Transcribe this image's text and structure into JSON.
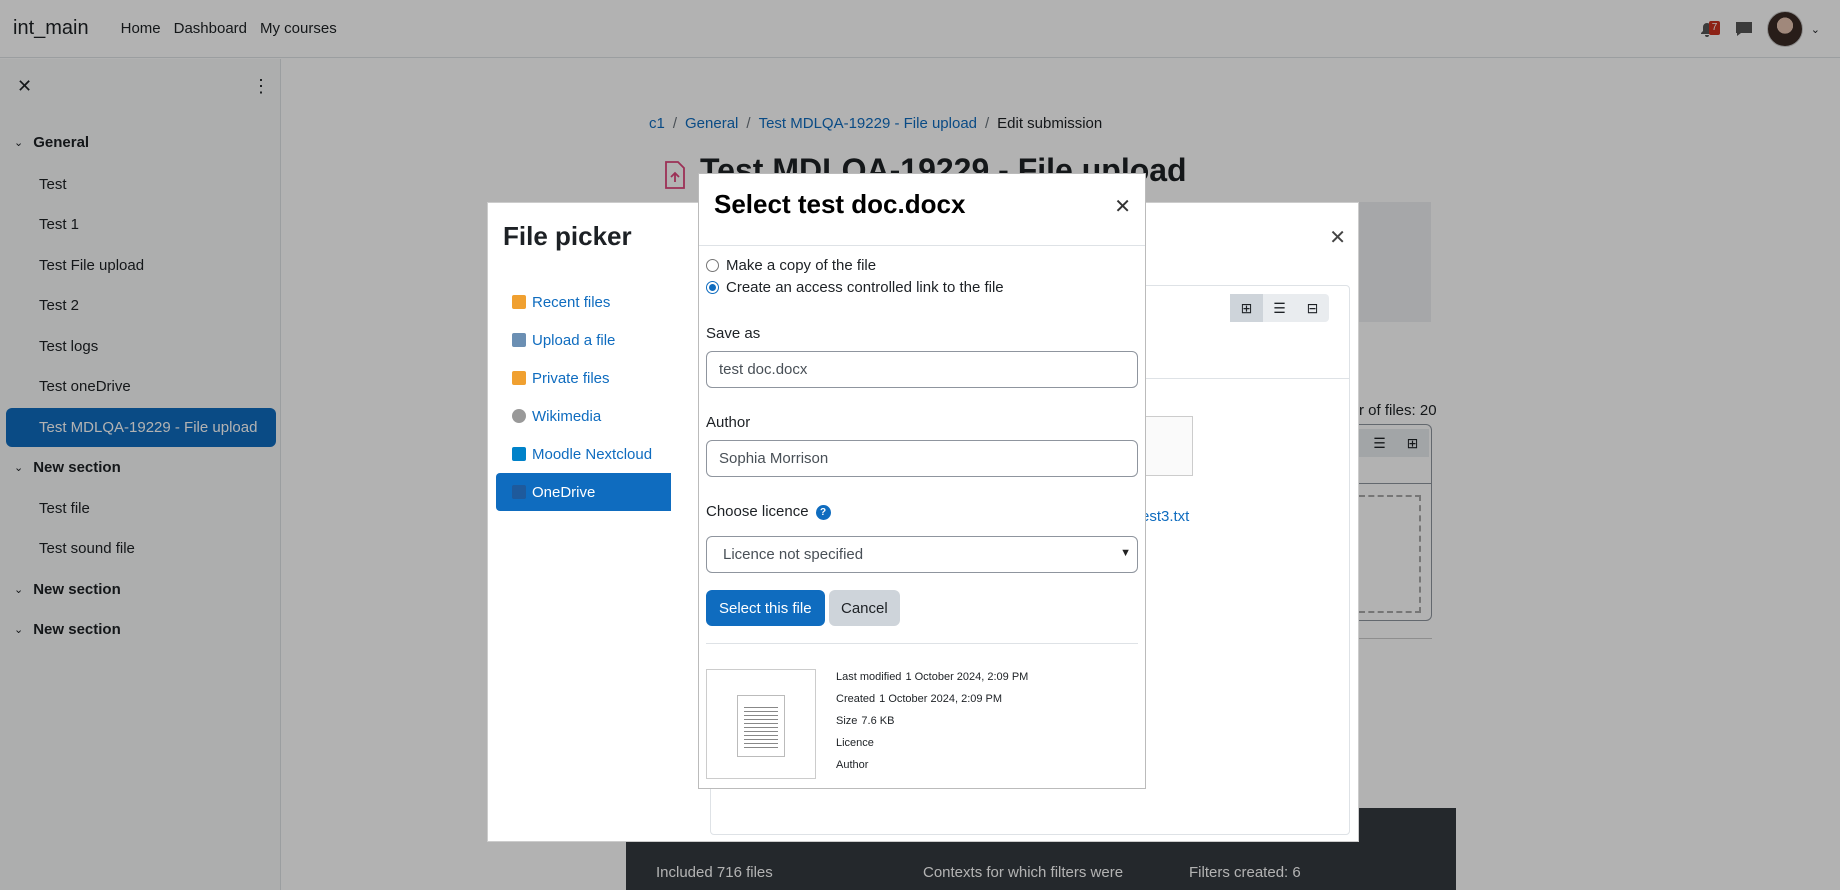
{
  "navbar": {
    "brand": "int_main",
    "links": [
      "Home",
      "Dashboard",
      "My courses"
    ],
    "notification_count": "7"
  },
  "drawer": {
    "sections": [
      {
        "title": "General",
        "items": [
          "Test",
          "Test 1",
          "Test File upload",
          "Test 2",
          "Test logs",
          "Test oneDrive",
          "Test MDLQA-19229 - File upload"
        ]
      },
      {
        "title": "New section",
        "items": [
          "Test file",
          "Test sound file"
        ]
      },
      {
        "title": "New section",
        "items": []
      },
      {
        "title": "New section",
        "items": []
      }
    ],
    "active_item": "Test MDLQA-19229 - File upload"
  },
  "breadcrumb": [
    "c1",
    "General",
    "Test MDLQA-19229 - File upload",
    "Edit submission"
  ],
  "page_heading": "Test MDLQA-19229 - File upload",
  "footer": {
    "included": "Included 716 files",
    "contexts": "Contexts for which filters were",
    "filters": "Filters created: 6"
  },
  "behind": {
    "files_count": "r of files: 20",
    "filename": "est3.txt"
  },
  "file_picker": {
    "title": "File picker",
    "repos": [
      "Recent files",
      "Upload a file",
      "Private files",
      "Wikimedia",
      "Moodle Nextcloud",
      "OneDrive"
    ],
    "active_repo": "OneDrive"
  },
  "dialog": {
    "title": "Select test doc.docx",
    "radio_copy": "Make a copy of the file",
    "radio_link": "Create an access controlled link to the file",
    "save_as_label": "Save as",
    "save_as_value": "test doc.docx",
    "author_label": "Author",
    "author_value": "Sophia Morrison",
    "licence_label": "Choose licence",
    "licence_value": "Licence not specified",
    "select_button": "Select this file",
    "cancel_button": "Cancel",
    "meta": {
      "last_modified_label": "Last modified",
      "last_modified": "1 October 2024, 2:09 PM",
      "created_label": "Created",
      "created": "1 October 2024, 2:09 PM",
      "size_label": "Size",
      "size": "7.6 KB",
      "licence_label": "Licence",
      "author_label": "Author"
    }
  },
  "colors": {
    "primary": "#0f6cbf",
    "badge": "#ca3120",
    "footer": "#343a40"
  }
}
